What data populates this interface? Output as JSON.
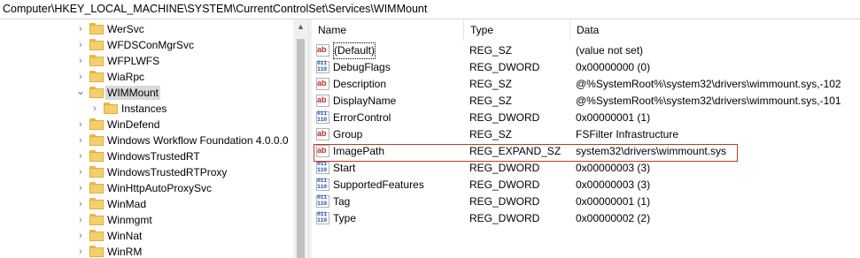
{
  "address_bar": {
    "path": "Computer\\HKEY_LOCAL_MACHINE\\SYSTEM\\CurrentControlSet\\Services\\WIMMount"
  },
  "tree": {
    "items": [
      {
        "label": "WerSvc"
      },
      {
        "label": "WFDSConMgrSvc"
      },
      {
        "label": "WFPLWFS"
      },
      {
        "label": "WiaRpc"
      },
      {
        "label": "WIMMount",
        "state": "expanded",
        "selected": true
      },
      {
        "label": "Instances",
        "level": "child"
      },
      {
        "label": "WinDefend"
      },
      {
        "label": "Windows Workflow Foundation 4.0.0.0"
      },
      {
        "label": "WindowsTrustedRT"
      },
      {
        "label": "WindowsTrustedRTProxy"
      },
      {
        "label": "WinHttpAutoProxySvc"
      },
      {
        "label": "WinMad"
      },
      {
        "label": "Winmgmt"
      },
      {
        "label": "WinNat"
      },
      {
        "label": "WinRM"
      }
    ],
    "chevron_collapsed": "›",
    "chevron_expanded": "⌄"
  },
  "values_panel": {
    "columns": {
      "name": "Name",
      "type": "Type",
      "data": "Data"
    },
    "rows": [
      {
        "icon": "ab",
        "name": "(Default)",
        "type": "REG_SZ",
        "data": "(value not set)"
      },
      {
        "icon": "bin",
        "name": "DebugFlags",
        "type": "REG_DWORD",
        "data": "0x00000000 (0)"
      },
      {
        "icon": "ab",
        "name": "Description",
        "type": "REG_SZ",
        "data": "@%SystemRoot%\\system32\\drivers\\wimmount.sys,-102"
      },
      {
        "icon": "ab",
        "name": "DisplayName",
        "type": "REG_SZ",
        "data": "@%SystemRoot%\\system32\\drivers\\wimmount.sys,-101"
      },
      {
        "icon": "bin",
        "name": "ErrorControl",
        "type": "REG_DWORD",
        "data": "0x00000001 (1)"
      },
      {
        "icon": "ab",
        "name": "Group",
        "type": "REG_SZ",
        "data": "FSFilter Infrastructure"
      },
      {
        "icon": "ab",
        "name": "ImagePath",
        "type": "REG_EXPAND_SZ",
        "data": "system32\\drivers\\wimmount.sys",
        "highlighted": true
      },
      {
        "icon": "bin",
        "name": "Start",
        "type": "REG_DWORD",
        "data": "0x00000003 (3)"
      },
      {
        "icon": "bin",
        "name": "SupportedFeatures",
        "type": "REG_DWORD",
        "data": "0x00000003 (3)"
      },
      {
        "icon": "bin",
        "name": "Tag",
        "type": "REG_DWORD",
        "data": "0x00000001 (1)"
      },
      {
        "icon": "bin",
        "name": "Type",
        "type": "REG_DWORD",
        "data": "0x00000002 (2)"
      }
    ],
    "icon_text": {
      "ab": "ab",
      "bin_line1": "011",
      "bin_line2": "110"
    }
  },
  "colors": {
    "highlight": "#c0392b",
    "folder": "#f5cf68",
    "selection": "#d9d9d9"
  }
}
